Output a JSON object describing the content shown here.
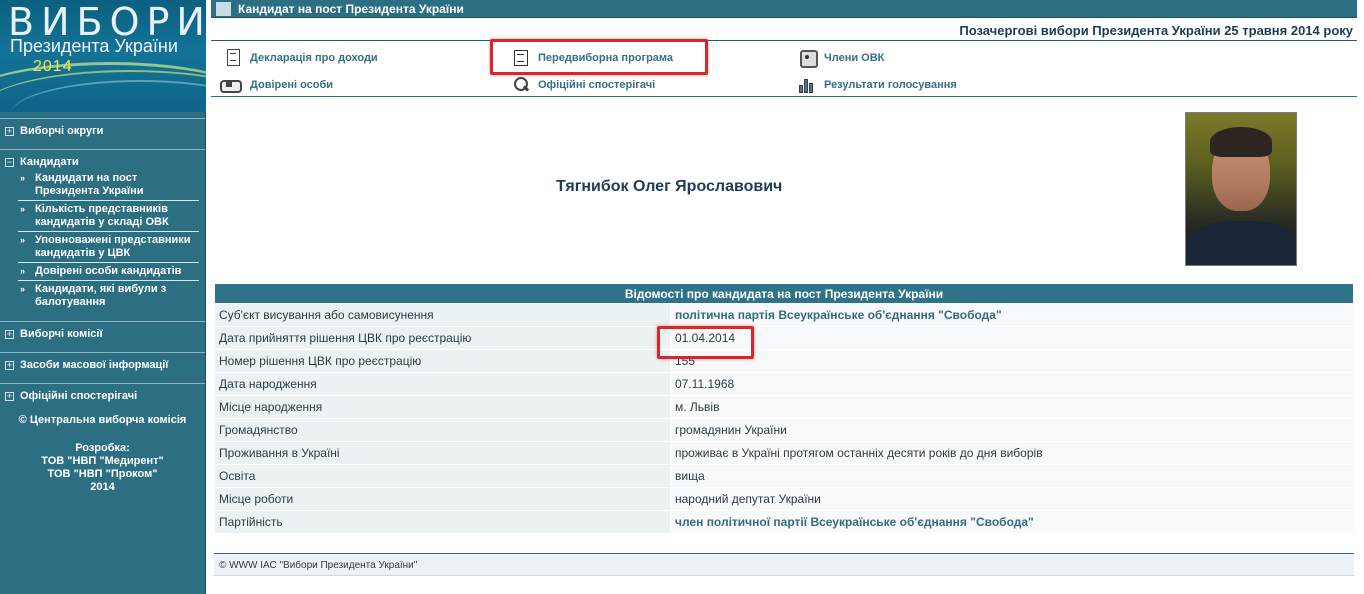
{
  "logo": {
    "title": "ВИБОРИ",
    "subtitle": "Президента України",
    "year": "2014"
  },
  "sidebar": {
    "sections": [
      {
        "label": "Виборчі округи"
      },
      {
        "label": "Кандидати"
      },
      {
        "label": "Виборчі комісії"
      },
      {
        "label": "Засоби масової інформації"
      },
      {
        "label": "Офіційні спостерігачі"
      }
    ],
    "candidates_items": [
      {
        "label": "Кандидати на пост Президента України"
      },
      {
        "label": "Кількість представників кандидатів у складі ОВК"
      },
      {
        "label": "Уповноважені представники кандидатів у ЦВК"
      },
      {
        "label": "Довірені особи кандидатів"
      },
      {
        "label": "Кандидати, які вибули з балотування"
      }
    ],
    "copyright": "© Центральна виборча комісія",
    "dev_label": "Розробка:",
    "dev_line1": "ТОВ \"НВП \"Медирент\"",
    "dev_line2": "ТОВ \"НВП \"Проком\"",
    "dev_year": "2014"
  },
  "header": {
    "title": "Кандидат на пост Президента України",
    "election": "Позачергові вибори Президента України 25 травня 2014 року"
  },
  "links": [
    {
      "label": "Декларація про доходи",
      "icon": "document-icon"
    },
    {
      "label": "Передвиборна програма",
      "icon": "program-icon"
    },
    {
      "label": "Члени ОВК",
      "icon": "commission-icon"
    },
    {
      "label": "Довірені особи",
      "icon": "handshake-icon"
    },
    {
      "label": "Офіційні спостерігачі",
      "icon": "observer-icon"
    },
    {
      "label": "Результати голосування",
      "icon": "bar-chart-icon"
    }
  ],
  "candidate": {
    "name": "Тягнибок Олег Ярославович"
  },
  "table": {
    "header": "Відомості про кандидата на пост Президента України",
    "rows": [
      {
        "key": "Суб'єкт висування або самовисунення",
        "value": "політична партія Всеукраїнське об'єднання \"Свобода\""
      },
      {
        "key": "Дата прийняття рішення ЦВК про реєстрацію",
        "value": "01.04.2014"
      },
      {
        "key": "Номер рішення ЦВК про реєстрацію",
        "value": "155"
      },
      {
        "key": "Дата народження",
        "value": "07.11.1968"
      },
      {
        "key": "Місце народження",
        "value": "м. Львів"
      },
      {
        "key": "Громадянство",
        "value": "громадянин України"
      },
      {
        "key": "Проживання в Україні",
        "value": "проживає в Україні протягом останніх десяти років до дня виборів"
      },
      {
        "key": "Освіта",
        "value": "вища"
      },
      {
        "key": "Місце роботи",
        "value": "народний депутат України"
      },
      {
        "key": "Партійність",
        "value": "член політичної партії Всеукраїнське об'єднання \"Свобода\""
      }
    ]
  },
  "footer": {
    "text": "© WWW ІАС \"Вибори Президента України\""
  },
  "colors": {
    "accent": "#2c6f83",
    "highlight": "#d8262a"
  }
}
